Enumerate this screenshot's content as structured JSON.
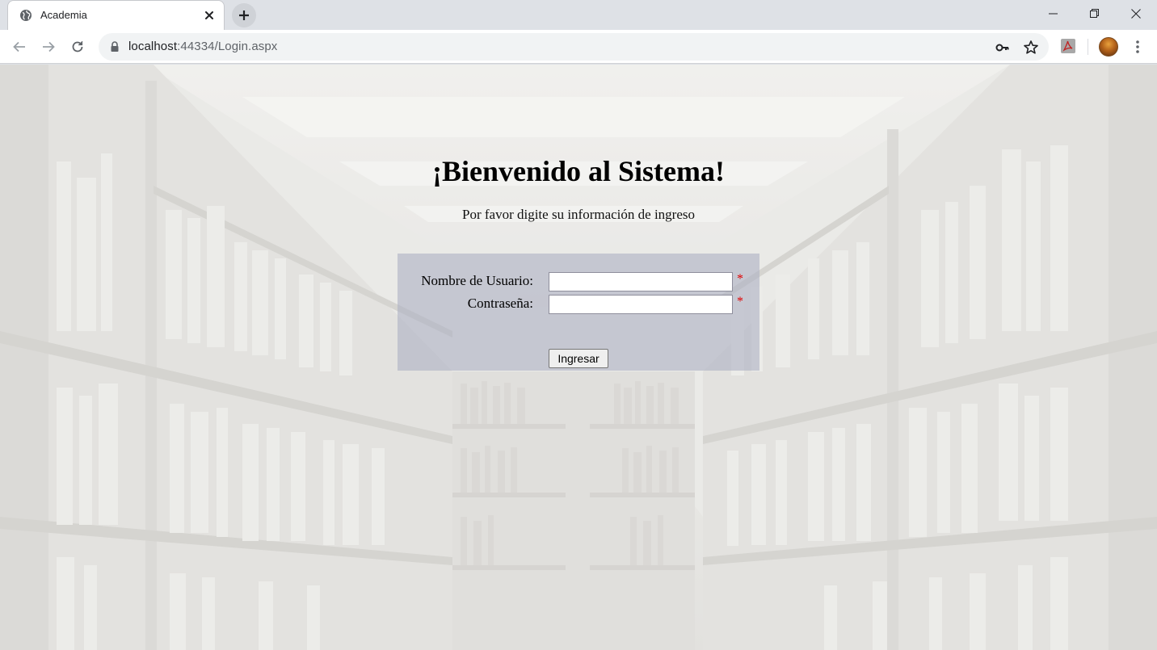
{
  "browser": {
    "tab_title": "Academia",
    "url_host": "localhost",
    "url_path": ":44334/Login.aspx"
  },
  "icons": {
    "tab_favicon": "globe-icon",
    "tab_close": "close-icon",
    "new_tab": "plus-icon",
    "back": "arrow-left-icon",
    "forward": "arrow-right-icon",
    "reload": "reload-icon",
    "secure": "lock-icon",
    "password": "key-icon",
    "bookmark": "star-icon",
    "extension": "pdf-extension-icon",
    "menu": "kebab-menu-icon"
  },
  "page": {
    "heading": "¡Bienvenido al Sistema!",
    "subheading": "Por favor digite su información de ingreso",
    "form": {
      "username_label": "Nombre de Usuario:",
      "password_label": "Contraseña:",
      "username_value": "",
      "password_value": "",
      "required_marker": "*",
      "submit_label": "Ingresar"
    }
  },
  "colors": {
    "panel": "#afb2c4",
    "required": "#e00000",
    "background": "#e9e8e5"
  }
}
